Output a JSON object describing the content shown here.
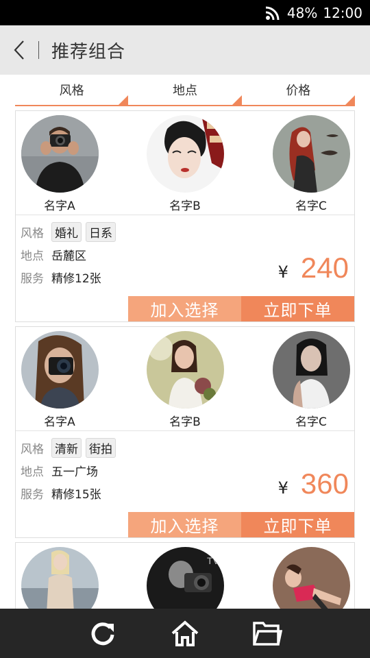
{
  "status_bar": {
    "battery": "48%",
    "time": "12:00",
    "icons": [
      "wifi-icon"
    ]
  },
  "nav": {
    "title": "推荐组合",
    "back_icon": "back-arrow-icon"
  },
  "filters": [
    {
      "label": "风格"
    },
    {
      "label": "地点"
    },
    {
      "label": "价格"
    }
  ],
  "cards": [
    {
      "people": [
        {
          "name": "名字A",
          "photo": "photographer-man-camera"
        },
        {
          "name": "名字B",
          "photo": "geisha-makeup-woman"
        },
        {
          "name": "名字C",
          "photo": "red-hair-woman-fish"
        }
      ],
      "style_label": "风格",
      "style_tags": [
        "婚礼",
        "日系"
      ],
      "location_label": "地点",
      "location": "岳麓区",
      "service_label": "服务",
      "service": "精修12张",
      "currency": "¥",
      "price": "240",
      "add_label": "加入选择",
      "order_label": "立即下单"
    },
    {
      "people": [
        {
          "name": "名字A",
          "photo": "woman-with-camera"
        },
        {
          "name": "名字B",
          "photo": "woman-with-flowers"
        },
        {
          "name": "名字C",
          "photo": "woman-white-dress"
        }
      ],
      "style_label": "风格",
      "style_tags": [
        "清新",
        "街拍"
      ],
      "location_label": "地点",
      "location": "五一广场",
      "service_label": "服务",
      "service": "精修15张",
      "currency": "¥",
      "price": "360",
      "add_label": "加入选择",
      "order_label": "立即下单"
    },
    {
      "people": [
        {
          "photo": "woman-coat-street"
        },
        {
          "photo": "photographer-bw"
        },
        {
          "photo": "woman-red-top"
        }
      ]
    }
  ],
  "bottom_bar": {
    "icons": [
      "refresh-icon",
      "home-icon",
      "folder-icon"
    ]
  },
  "colors": {
    "accent": "#f0875a",
    "accent_light": "#f5a57c",
    "bar": "#262626"
  }
}
